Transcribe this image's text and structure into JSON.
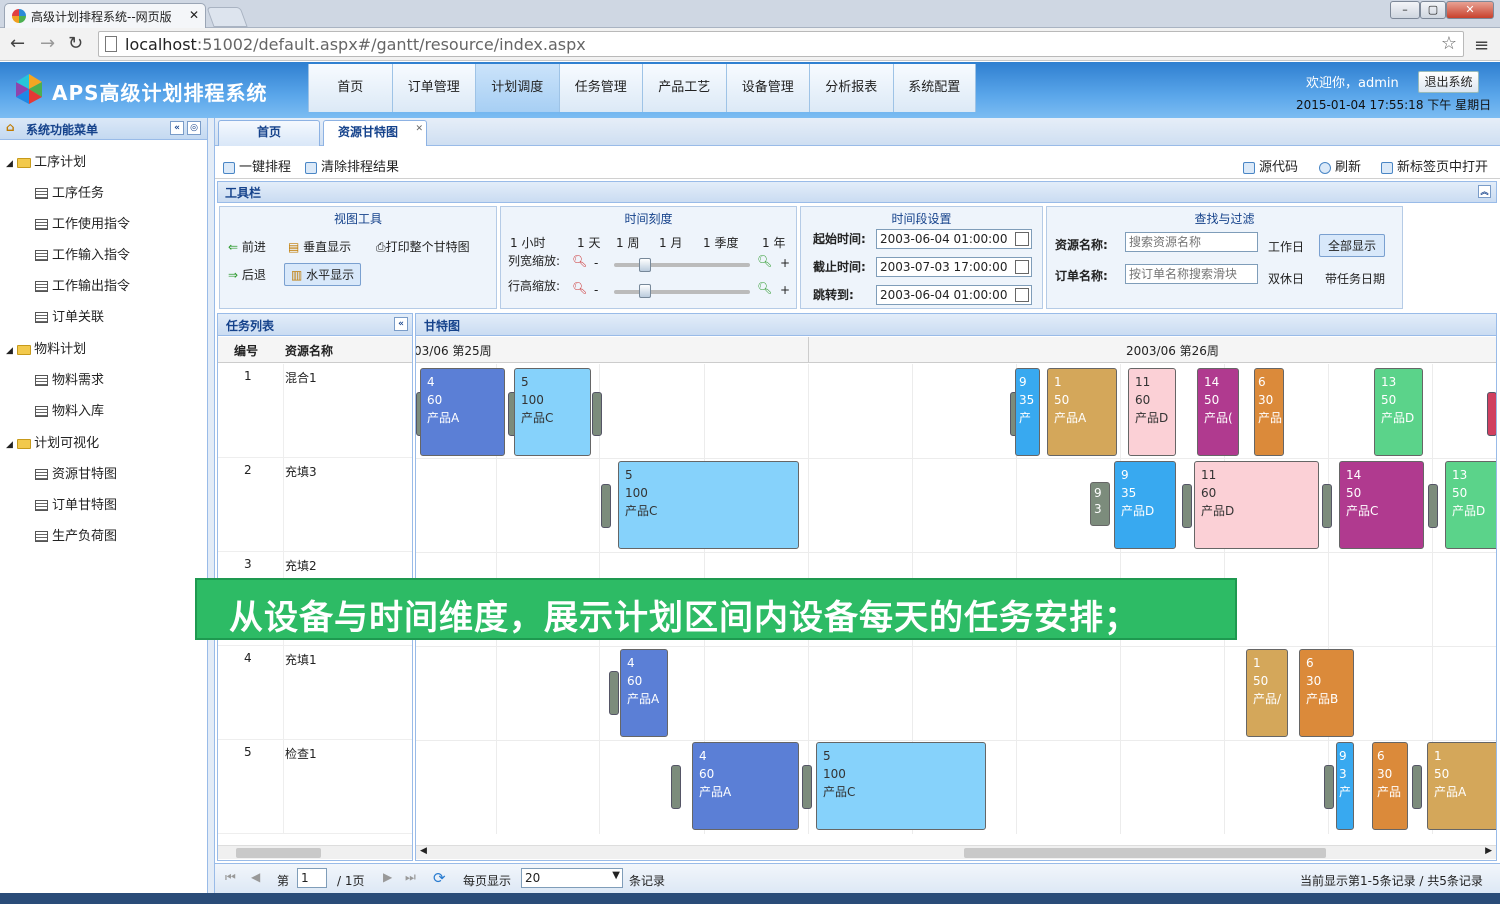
{
  "browser": {
    "tab_title": "高级计划排程系统--网页版",
    "url_host": "localhost",
    "url_rest": ":51002/default.aspx#/gantt/resource/index.aspx"
  },
  "app": {
    "title": "APS高级计划排程系统",
    "nav": [
      "首页",
      "订单管理",
      "计划调度",
      "任务管理",
      "产品工艺",
      "设备管理",
      "分析报表",
      "系统配置"
    ],
    "active_nav": "计划调度",
    "welcome": "欢迎你，admin",
    "logout": "退出系统",
    "clock": "2015-01-04 17:55:18 下午 星期日"
  },
  "sidebar": {
    "title": "系统功能菜单",
    "groups": [
      {
        "label": "工序计划",
        "items": [
          "工序任务",
          "工作使用指令",
          "工作输入指令",
          "工作输出指令",
          "订单关联"
        ]
      },
      {
        "label": "物料计划",
        "items": [
          "物料需求",
          "物料入库"
        ]
      },
      {
        "label": "计划可视化",
        "items": [
          "资源甘特图",
          "订单甘特图",
          "生产负荷图"
        ]
      }
    ]
  },
  "content_tabs": [
    "首页",
    "资源甘特图"
  ],
  "actions": {
    "one_click": "一键排程",
    "clear": "清除排程结果",
    "source": "源代码",
    "refresh": "刷新",
    "new_tab": "新标签页中打开"
  },
  "toolbar": {
    "title": "工具栏",
    "view_tools": {
      "title": "视图工具",
      "forward": "前进",
      "vertical": "垂直显示",
      "print": "打印整个甘特图",
      "back": "后退",
      "horizontal": "水平显示"
    },
    "time_scale": {
      "title": "时间刻度",
      "units": [
        "1 小时",
        "1 天",
        "1 周",
        "1 月",
        "1 季度",
        "1 年"
      ],
      "col_zoom": "列宽缩放:",
      "row_zoom": "行高缩放:",
      "minus": "-",
      "plus": "+"
    },
    "time_range": {
      "title": "时间段设置",
      "start_label": "起始时间:",
      "start": "2003-06-04 01:00:00",
      "end_label": "截止时间:",
      "end": "2003-07-03 17:00:00",
      "jump_label": "跳转到:",
      "jump": "2003-06-04 01:00:00"
    },
    "filter": {
      "title": "查找与过滤",
      "resource_label": "资源名称:",
      "resource_ph": "搜索资源名称",
      "order_label": "订单名称:",
      "order_ph": "按订单名称搜索滑块",
      "workday": "工作日",
      "show_all": "全部显示",
      "weekend": "双休日",
      "with_date": "带任务日期"
    }
  },
  "task_list": {
    "title": "任务列表",
    "col_id": "编号",
    "col_name": "资源名称",
    "rows": [
      {
        "id": "1",
        "name": "混合1"
      },
      {
        "id": "2",
        "name": "充填3"
      },
      {
        "id": "3",
        "name": "充填2"
      },
      {
        "id": "4",
        "name": "充填1"
      },
      {
        "id": "5",
        "name": "检查1"
      }
    ]
  },
  "gantt": {
    "title": "甘特图",
    "week1": "03/06 第25周",
    "week2": "2003/06 第26周",
    "tasks": [
      {
        "text": "4\n60\n产品A",
        "color": "#5b7fd6",
        "light": false
      },
      {
        "text": "5\n100\n产品C",
        "color": "#86d2fb",
        "light": true
      },
      {
        "text": "9\n35\n产",
        "color": "#38a9f0",
        "light": false
      },
      {
        "text": "1\n50\n产品A",
        "color": "#d4a75a",
        "light": false
      },
      {
        "text": "11\n60\n产品D",
        "color": "#fbd0d6",
        "light": true
      },
      {
        "text": "14\n50\n产品(",
        "color": "#b03a8f",
        "light": false
      },
      {
        "text": "6\n30\n产品",
        "color": "#db8a3a",
        "light": false
      },
      {
        "text": "13\n50\n产品D",
        "color": "#5bd38a",
        "light": false
      },
      {
        "text": "5\n100\n产品C",
        "color": "#86d2fb",
        "light": true
      },
      {
        "text": "9\n3",
        "color": "#7c8c7c",
        "light": false
      },
      {
        "text": "9\n35\n产品D",
        "color": "#38a9f0",
        "light": false
      },
      {
        "text": "11\n60\n产品D",
        "color": "#fbd0d6",
        "light": true
      },
      {
        "text": "14\n50\n产品C",
        "color": "#b03a8f",
        "light": false
      },
      {
        "text": "13\n50\n产品D",
        "color": "#5bd38a",
        "light": false
      },
      {
        "text": "4\n60\n产品A",
        "color": "#5b7fd6",
        "light": false
      },
      {
        "text": "1\n50\n产品/",
        "color": "#d4a75a",
        "light": false
      },
      {
        "text": "6\n30\n产品B",
        "color": "#db8a3a",
        "light": false
      },
      {
        "text": "4\n60\n产品A",
        "color": "#5b7fd6",
        "light": false
      },
      {
        "text": "5\n100\n产品C",
        "color": "#86d2fb",
        "light": true
      },
      {
        "text": "9\n3\n产",
        "color": "#38a9f0",
        "light": false
      },
      {
        "text": "6\n30\n产品",
        "color": "#db8a3a",
        "light": false
      },
      {
        "text": "1\n50\n产品A",
        "color": "#d4a75a",
        "light": false
      }
    ]
  },
  "pager": {
    "page_label": "第",
    "page": "1",
    "of_pages": "/ 1页",
    "per_page_label": "每页显示",
    "per_page": "20",
    "records_label": "条记录",
    "summary": "当前显示第1-5条记录 / 共5条记录"
  },
  "banner": "从设备与时间维度，展示计划区间内设备每天的任务安排；",
  "colors": {
    "accent": "#15428b",
    "banner": "#2dbb65",
    "header": "#4a98e2"
  }
}
